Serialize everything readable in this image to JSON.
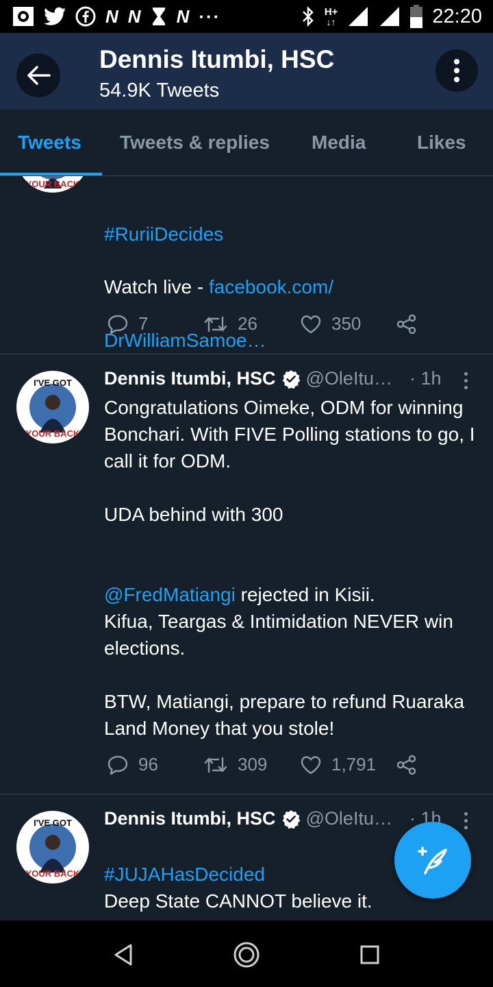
{
  "status_bar": {
    "time": "22:20",
    "left_icons": [
      "notification-app-icon",
      "twitter-icon",
      "facebook-icon",
      "nation-n-icon",
      "nation-n-icon",
      "hourglass-app-icon",
      "nation-n-icon",
      "more-dots-icon"
    ],
    "right_icons": [
      "bluetooth-icon",
      "hplus-data-icon",
      "signal-icon",
      "signal-icon",
      "battery-icon"
    ],
    "network_label": "H+"
  },
  "header": {
    "title": "Dennis Itumbi, HSC",
    "subtitle": "54.9K Tweets"
  },
  "tabs": [
    {
      "label": "Tweets",
      "active": true
    },
    {
      "label": "Tweets & replies",
      "active": false
    },
    {
      "label": "Media",
      "active": false
    },
    {
      "label": "Likes",
      "active": false
    }
  ],
  "tweets": [
    {
      "hashtag": "#RuriiDecides",
      "watch_prefix": "Watch live - ",
      "link_line1": "facebook.com/",
      "link_line2": "DrWilliamSamoe…",
      "replies": "7",
      "retweets": "26",
      "likes": "350"
    },
    {
      "name": "Dennis Itumbi, HSC",
      "handle": "@OleItu…",
      "time": "· 1h",
      "p1": "Congratulations Oimeke, ODM for winning Bonchari. With FIVE Polling stations to go, I call it for ODM.",
      "p2": "UDA behind with 300",
      "mention": "@FredMatiangi",
      "p3_rest": " rejected in Kisii.",
      "p4": "Kifua, Teargas & Intimidation NEVER win elections.",
      "p5": "BTW, Matiangi, prepare to refund Ruaraka Land Money that you stole!",
      "replies": "96",
      "retweets": "309",
      "likes": "1,791"
    },
    {
      "name": "Dennis Itumbi, HSC",
      "handle": "@OleItu…",
      "time": "· 1h",
      "hashtag": "#JUJAHasDecided",
      "p1": "Deep State CANNOT believe it."
    }
  ],
  "avatar_text": {
    "top": "I'VE GOT",
    "bottom": "YOUR BACK"
  },
  "colors": {
    "background": "#15202b",
    "header": "#1c2d49",
    "accent": "#1da1f2",
    "muted": "#8899a6",
    "divider": "#38444d"
  }
}
